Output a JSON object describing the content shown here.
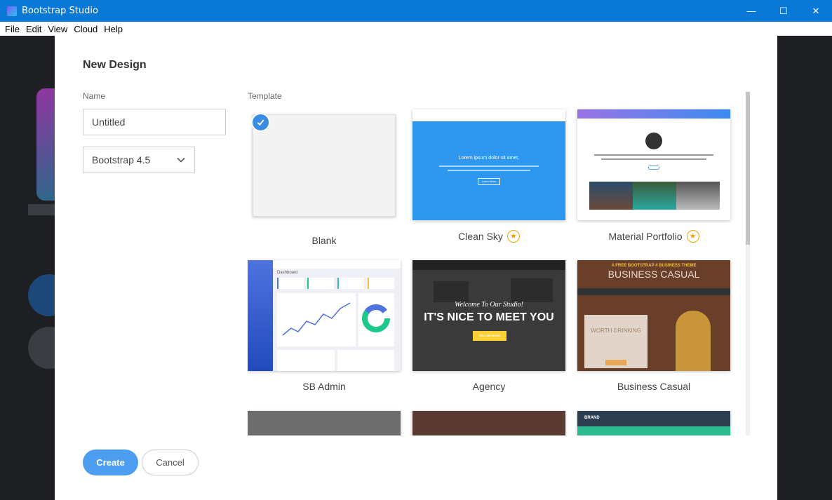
{
  "window": {
    "title": "Bootstrap Studio",
    "controls": [
      "—",
      "☐",
      "✕"
    ]
  },
  "menu": [
    "File",
    "Edit",
    "View",
    "Cloud",
    "Help"
  ],
  "dialog": {
    "title": "New Design",
    "name_label": "Name",
    "name_value": "Untitled",
    "framework_value": "Bootstrap 4.5",
    "template_label": "Template",
    "create_label": "Create",
    "cancel_label": "Cancel"
  },
  "templates": [
    {
      "label": "Blank",
      "premium": false,
      "selected": true
    },
    {
      "label": "Clean Sky",
      "premium": true,
      "selected": false
    },
    {
      "label": "Material Portfolio",
      "premium": true,
      "selected": false
    },
    {
      "label": "SB Admin",
      "premium": false,
      "selected": false
    },
    {
      "label": "Agency",
      "premium": false,
      "selected": false
    },
    {
      "label": "Business Casual",
      "premium": false,
      "selected": false
    }
  ],
  "thumb_text": {
    "sky_headline": "Lorem ipsum dolor sit amet.",
    "sky_button": "Learn More",
    "agency_welcome": "Welcome To Our Studio!",
    "agency_headline": "IT'S NICE TO MEET YOU",
    "agency_button": "TELL ME MORE",
    "cafe_tag": "A FREE BOOTSTRAP 4 BUSINESS THEME",
    "cafe_title": "BUSINESS CASUAL",
    "cafe_card_title": "WORTH DRINKING",
    "sb_title": "Dashboard",
    "brand": "BRAND"
  },
  "colors": {
    "accent": "#4d9ef0",
    "titlebar": "#0a78d7",
    "star": "#f0a400"
  }
}
